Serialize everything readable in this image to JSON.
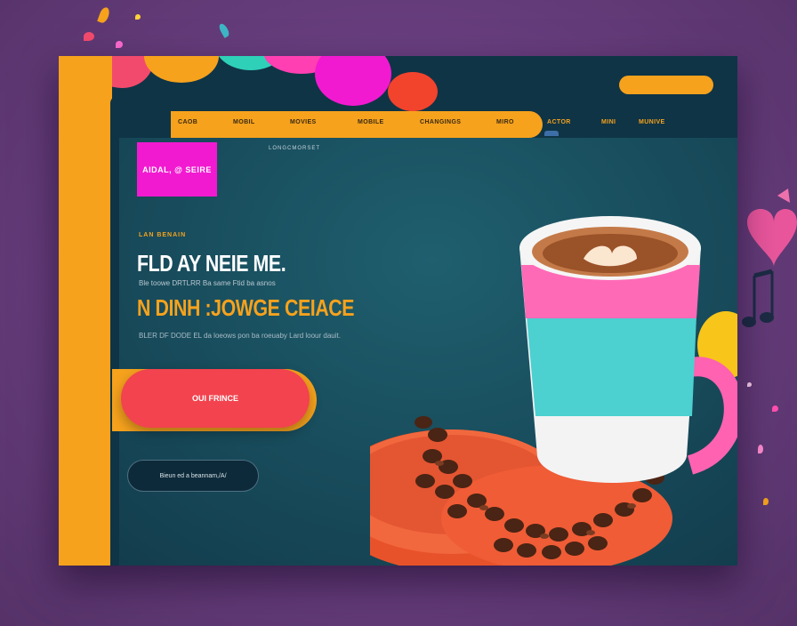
{
  "header": {
    "cta_label": "",
    "nav": [
      "CAOB",
      "MOBIL",
      "MOVIES",
      "MOBILE",
      "CHANGINGS",
      "MIRO",
      "ACTOR",
      "MINI",
      "MUNIVE"
    ]
  },
  "brand": {
    "badge": "AIDAL, @ SEIRE",
    "caption": "LONGCMORSET"
  },
  "hero": {
    "eyebrow": "LAN BENAIN",
    "headline": "FLD AY NEIE ME.",
    "subline": "Ble toowe DRTLRR Ba same Ftid ba asnos",
    "headline2": "N DINH :JOWGE CEIACE",
    "body": "BLER DF DODE EL da loeows pon ba roeuaby Lard loour dauit."
  },
  "actions": {
    "primary": "OUI FRINCE",
    "secondary": "Bieun ed a beannam,/A/"
  },
  "colors": {
    "accent_orange": "#f6a21d",
    "brand_pink": "#f21ad0",
    "button_red": "#f2434e",
    "dark_teal": "#123a4a"
  }
}
